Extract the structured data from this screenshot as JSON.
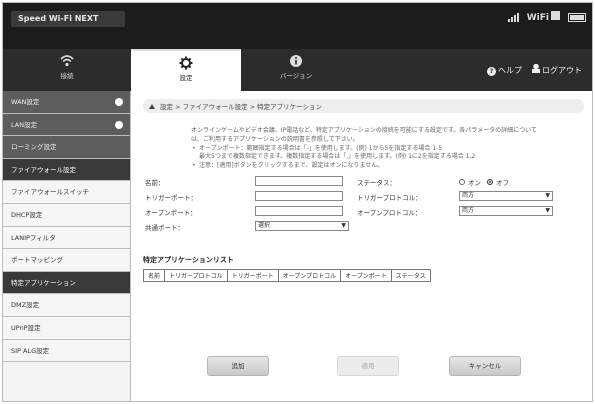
{
  "app": {
    "brand": "Speed Wi-Fi NEXT",
    "wifi_label": "WiFi"
  },
  "nav": {
    "tabs": [
      {
        "label": "接続",
        "icon": "wifi-signal-icon"
      },
      {
        "label": "設定",
        "icon": "gear-icon"
      },
      {
        "label": "バージョン",
        "icon": "info-icon"
      }
    ],
    "help": "ヘルプ",
    "logout": "ログアウト"
  },
  "sidebar": {
    "items": [
      {
        "label": "WAN設定",
        "expandable": true
      },
      {
        "label": "LAN設定",
        "expandable": true
      },
      {
        "label": "ローミング設定"
      },
      {
        "label": "ファイアウォール設定"
      },
      {
        "label": "ファイアウォールスイッチ"
      },
      {
        "label": "DHCP設定"
      },
      {
        "label": "LANIPフィルタ"
      },
      {
        "label": "ポートマッピング"
      },
      {
        "label": "特定アプリケーション"
      },
      {
        "label": "DMZ設定"
      },
      {
        "label": "UPnP設定"
      },
      {
        "label": "SIP ALG設定"
      }
    ]
  },
  "breadcrumb": "設定 > ファイアウォール設定 > 特定アプリケーション",
  "description": {
    "intro": "オンラインゲームやビデオ会議、IP電話など、特定アプリケーションの接続を可能にする設定です。各パラメータの詳細については、ご利用するアプリケーションの説明書を参照して下さい。",
    "notes": [
      "オープンポート：範囲指定する場合は「-」を使用します。(例) 1から5を指定する場合 1-5",
      "最大5つまで複数指定できます。複数指定する場合は「,」を使用します。(例) 1に2を指定する場合 1,2",
      "注意：[適用]ボタンをクリックするまで、設定はオンになりません。"
    ]
  },
  "form": {
    "name_label": "名前：",
    "status_label": "ステータス：",
    "status_on": "オン",
    "status_off": "オフ",
    "status_selected": "オフ",
    "trigger_port_label": "トリガーポート：",
    "trigger_protocol_label": "トリガープロトコル：",
    "trigger_protocol_value": "両方",
    "open_port_label": "オープンポート：",
    "open_protocol_label": "オープンプロトコル：",
    "open_protocol_value": "両方",
    "common_port_label": "共通ポート：",
    "common_port_value": "選択",
    "name_value": "",
    "trigger_port_value": "",
    "open_port_value": ""
  },
  "list": {
    "title": "特定アプリケーションリスト",
    "columns": [
      "名前",
      "トリガープロトコル",
      "トリガーポート",
      "オープンプロトコル",
      "オープンポート",
      "ステータス"
    ],
    "rows": []
  },
  "actions": {
    "add": "追加",
    "apply": "適用",
    "cancel": "キャンセル"
  }
}
